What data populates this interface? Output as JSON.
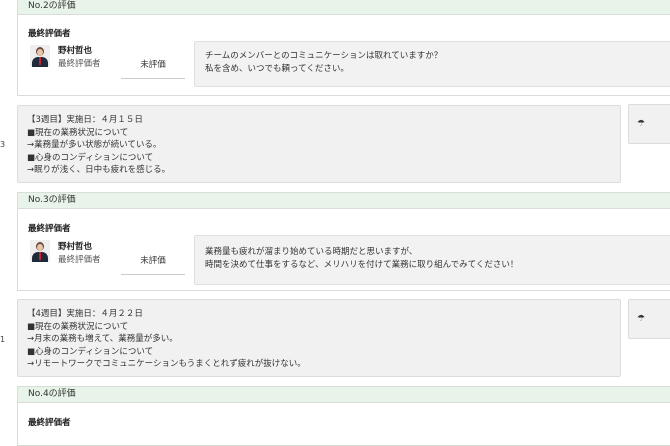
{
  "evaluations": [
    {
      "header": "No.2の評価",
      "evaluator_title": "最終評価者",
      "name": "野村哲也",
      "role": "最終評価者",
      "status": "未評価",
      "comment": [
        "チームのメンバーとのコミュニケーションは取れていますか？",
        "私を含め、いつでも頼ってください。"
      ]
    },
    {
      "header": "No.3の評価",
      "evaluator_title": "最終評価者",
      "name": "野村哲也",
      "role": "最終評価者",
      "status": "未評価",
      "comment": [
        "業務量も疲れが溜まり始めている時期だと思いますが、",
        "時間を決めて仕事をするなど、メリハリを付けて業務に取り組んでみてください！"
      ]
    },
    {
      "header": "No.4の評価",
      "evaluator_title": "最終評価者"
    }
  ],
  "reports": [
    {
      "edge_number": "3",
      "lines": [
        "【3週目】実施日：４月１５日",
        "■現在の業務状況について",
        "→業務量が多い状態が続いている。",
        "■心身のコンディションについて",
        "→眠りが浅く、日中も疲れを感じる。"
      ],
      "side_icon": "umbrella-icon"
    },
    {
      "edge_number": "1",
      "lines": [
        "【4週目】実施日：４月２２日",
        "■現在の業務状況について",
        "→月末の業務も増えて、業務量が多い。",
        "■心身のコンディションについて",
        "→リモートワークでコミュニケーションもうまくとれず疲れが抜けない。"
      ],
      "side_icon": "umbrella-icon"
    }
  ]
}
